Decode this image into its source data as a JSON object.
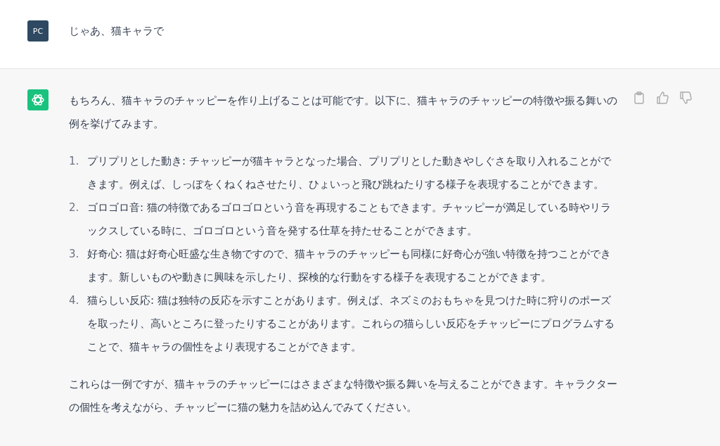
{
  "messages": [
    {
      "kind": "user",
      "avatar": "PC",
      "text": "じゃあ、猫キャラで"
    },
    {
      "kind": "assistant",
      "intro": "もちろん、猫キャラのチャッピーを作り上げることは可能です。以下に、猫キャラのチャッピーの特徴や振る舞いの例を挙げてみます。",
      "items": [
        {
          "number": "1.",
          "text": "プリプリとした動き: チャッピーが猫キャラとなった場合、プリプリとした動きやしぐさを取り入れることができます。例えば、しっぽをくねくねさせたり、ひょいっと飛び跳ねたりする様子を表現することができます。"
        },
        {
          "number": "2.",
          "text": "ゴロゴロ音: 猫の特徴であるゴロゴロという音を再現することもできます。チャッピーが満足している時やリラックスしている時に、ゴロゴロという音を発する仕草を持たせることができます。"
        },
        {
          "number": "3.",
          "text": "好奇心: 猫は好奇心旺盛な生き物ですので、猫キャラのチャッピーも同様に好奇心が強い特徴を持つことができます。新しいものや動きに興味を示したり、探検的な行動をする様子を表現することができます。"
        },
        {
          "number": "4.",
          "text": "猫らしい反応: 猫は独特の反応を示すことがあります。例えば、ネズミのおもちゃを見つけた時に狩りのポーズを取ったり、高いところに登ったりすることがあります。これらの猫らしい反応をチャッピーにプログラムすることで、猫キャラの個性をより表現することができます。"
        }
      ],
      "outro": "これらは一例ですが、猫キャラのチャッピーにはさまざまな特徴や振る舞いを与えることができます。キャラクターの個性を考えながら、チャッピーに猫の魅力を詰め込んでみてください。"
    }
  ]
}
